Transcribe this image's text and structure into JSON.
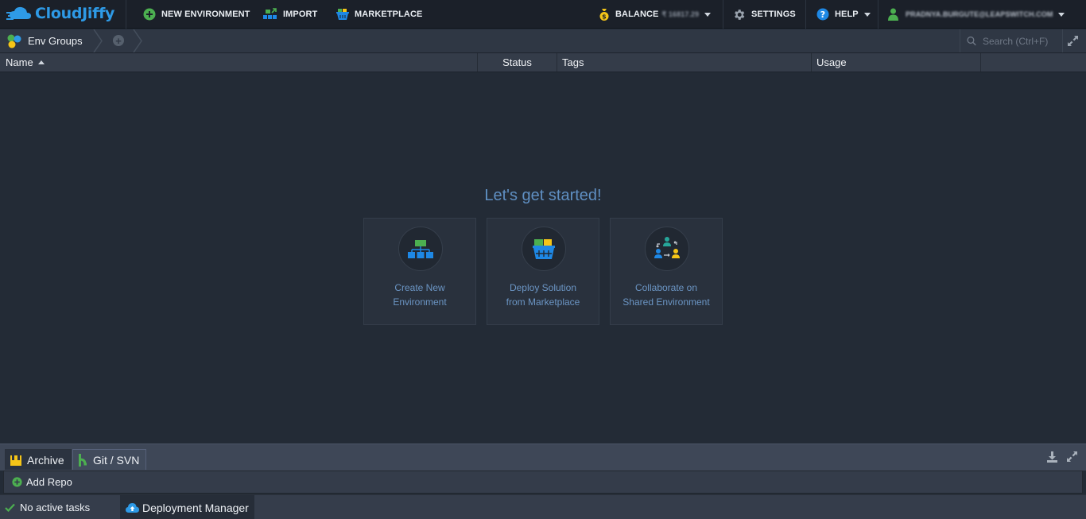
{
  "app": {
    "brand": "CloudJiffy"
  },
  "toolbar": {
    "new_environment": "NEW ENVIRONMENT",
    "import": "IMPORT",
    "marketplace": "MARKETPLACE",
    "balance_label": "BALANCE",
    "balance_value": "₹ 16817.29",
    "settings": "SETTINGS",
    "help": "HELP",
    "user_email": "PRADNYA.BURGUTE@LEAPSWITCH.COM"
  },
  "breadcrumb": {
    "root": "Env Groups"
  },
  "search": {
    "placeholder": "Search (Ctrl+F)"
  },
  "grid": {
    "columns": [
      {
        "label": "Name",
        "sort": "asc"
      },
      {
        "label": "Status"
      },
      {
        "label": "Tags"
      },
      {
        "label": "Usage"
      }
    ]
  },
  "welcome": {
    "title": "Let's get started!",
    "cards": [
      {
        "line1": "Create New",
        "line2": "Environment",
        "icon": "environment-topology-icon"
      },
      {
        "line1": "Deploy Solution",
        "line2": "from Marketplace",
        "icon": "marketplace-basket-icon"
      },
      {
        "line1": "Collaborate on",
        "line2": "Shared Environment",
        "icon": "collaboration-users-icon"
      }
    ]
  },
  "bottom": {
    "tabs": [
      {
        "label": "Archive",
        "active": false
      },
      {
        "label": "Git / SVN",
        "active": true
      }
    ],
    "add_repo": "Add Repo"
  },
  "status": {
    "tasks": "No active tasks",
    "deployment_manager": "Deployment Manager"
  },
  "colors": {
    "brand": "#2e9ae6",
    "accent_green": "#4caf50",
    "welcome_text": "#5f8fc2",
    "background": "#232b36"
  }
}
